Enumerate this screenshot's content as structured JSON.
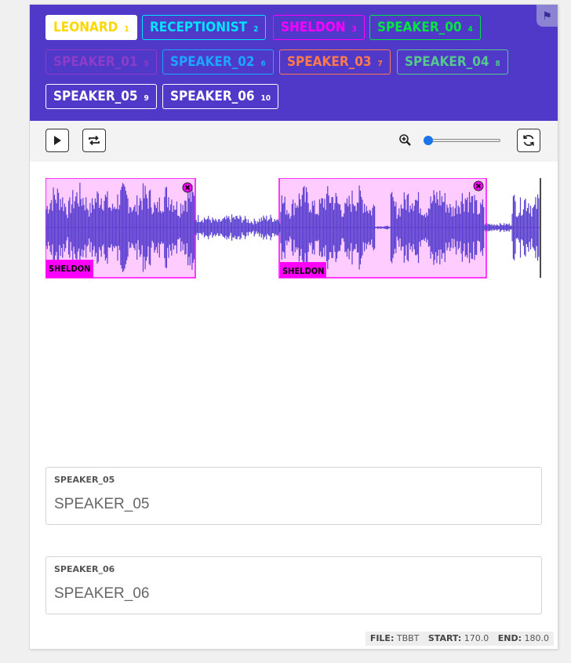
{
  "labels": [
    {
      "name": "LEONARD",
      "hotkey": "1",
      "color": "#ffd700",
      "selected": true
    },
    {
      "name": "RECEPTIONIST",
      "hotkey": "2",
      "color": "#00e5ff",
      "selected": false
    },
    {
      "name": "SHELDON",
      "hotkey": "3",
      "color": "#ff00ff",
      "selected": false
    },
    {
      "name": "SPEAKER_00",
      "hotkey": "4",
      "color": "#00e640",
      "selected": false
    },
    {
      "name": "SPEAKER_01",
      "hotkey": "5",
      "color": "#8b3cc8",
      "selected": false
    },
    {
      "name": "SPEAKER_02",
      "hotkey": "6",
      "color": "#1ca6ff",
      "selected": false
    },
    {
      "name": "SPEAKER_03",
      "hotkey": "7",
      "color": "#ff7a4a",
      "selected": false
    },
    {
      "name": "SPEAKER_04",
      "hotkey": "8",
      "color": "#55c78f",
      "selected": false
    },
    {
      "name": "SPEAKER_05",
      "hotkey": "9",
      "color": "#ffffff",
      "selected": false
    },
    {
      "name": "SPEAKER_06",
      "hotkey": "10",
      "color": "#ffffff",
      "selected": false
    }
  ],
  "toolbar": {
    "play_icon": "play-icon",
    "loop_icon": "repeat-icon",
    "zoom_icon": "zoom-in-icon",
    "zoom_level": 0.0,
    "reset_icon": "refresh-icon"
  },
  "waveform": {
    "wave_color": "#5a3fd0",
    "region_fill": "#ffccff",
    "region_border": "#ff00ff",
    "regions": [
      {
        "label": "SHELDON",
        "delete_icon": "close-icon"
      },
      {
        "label": "SHELDON",
        "delete_icon": "close-icon"
      }
    ]
  },
  "fields": [
    {
      "label": "SPEAKER_05",
      "value": "SPEAKER_05"
    },
    {
      "label": "SPEAKER_06",
      "value": "SPEAKER_06"
    }
  ],
  "footer": {
    "file_label": "FILE:",
    "file_value": "TBBT",
    "start_label": "START:",
    "start_value": "170.0",
    "end_label": "END:",
    "end_value": "180.0"
  },
  "header": {
    "flag_icon": "flag-icon"
  }
}
